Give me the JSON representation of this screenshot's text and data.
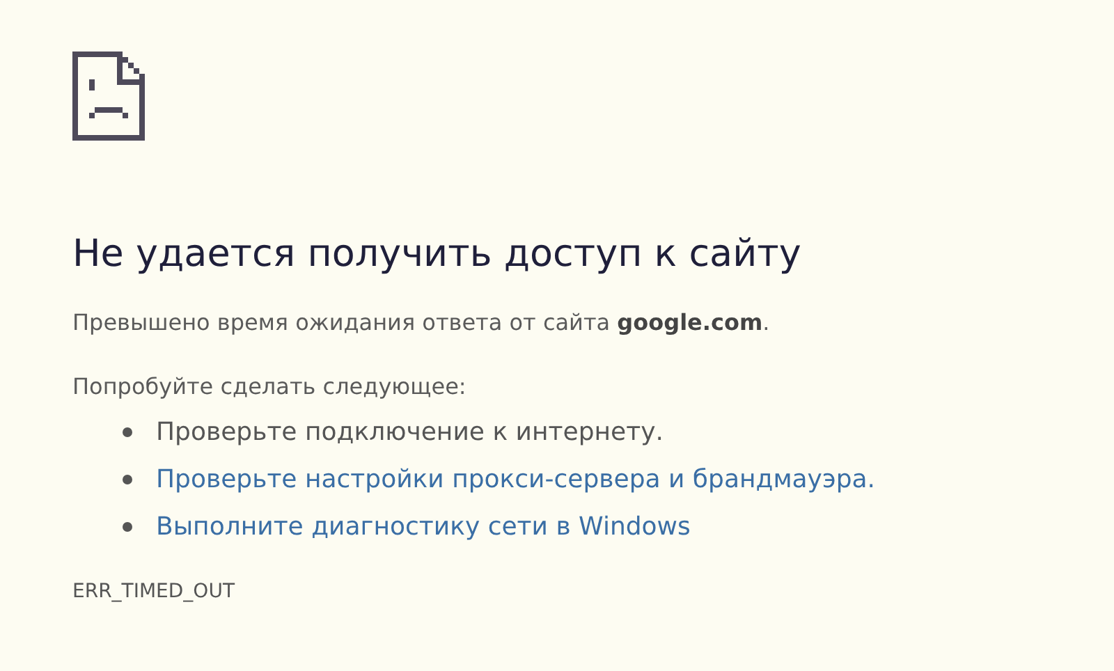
{
  "heading": "Не удается получить доступ к сайту",
  "message": "Превышено время ожидания ответа от сайта **google.com**.",
  "suggestions_intro": "Попробуйте сделать следующее:",
  "suggestions": [
    {
      "kind": "text",
      "label": "Проверьте подключение к интернету."
    },
    {
      "kind": "link",
      "label": "Проверьте настройки прокси-сервера и брандмауэра."
    },
    {
      "kind": "link",
      "label": "Выполните диагностику сети в Windows"
    }
  ],
  "error_code": "ERR_TIMED_OUT"
}
